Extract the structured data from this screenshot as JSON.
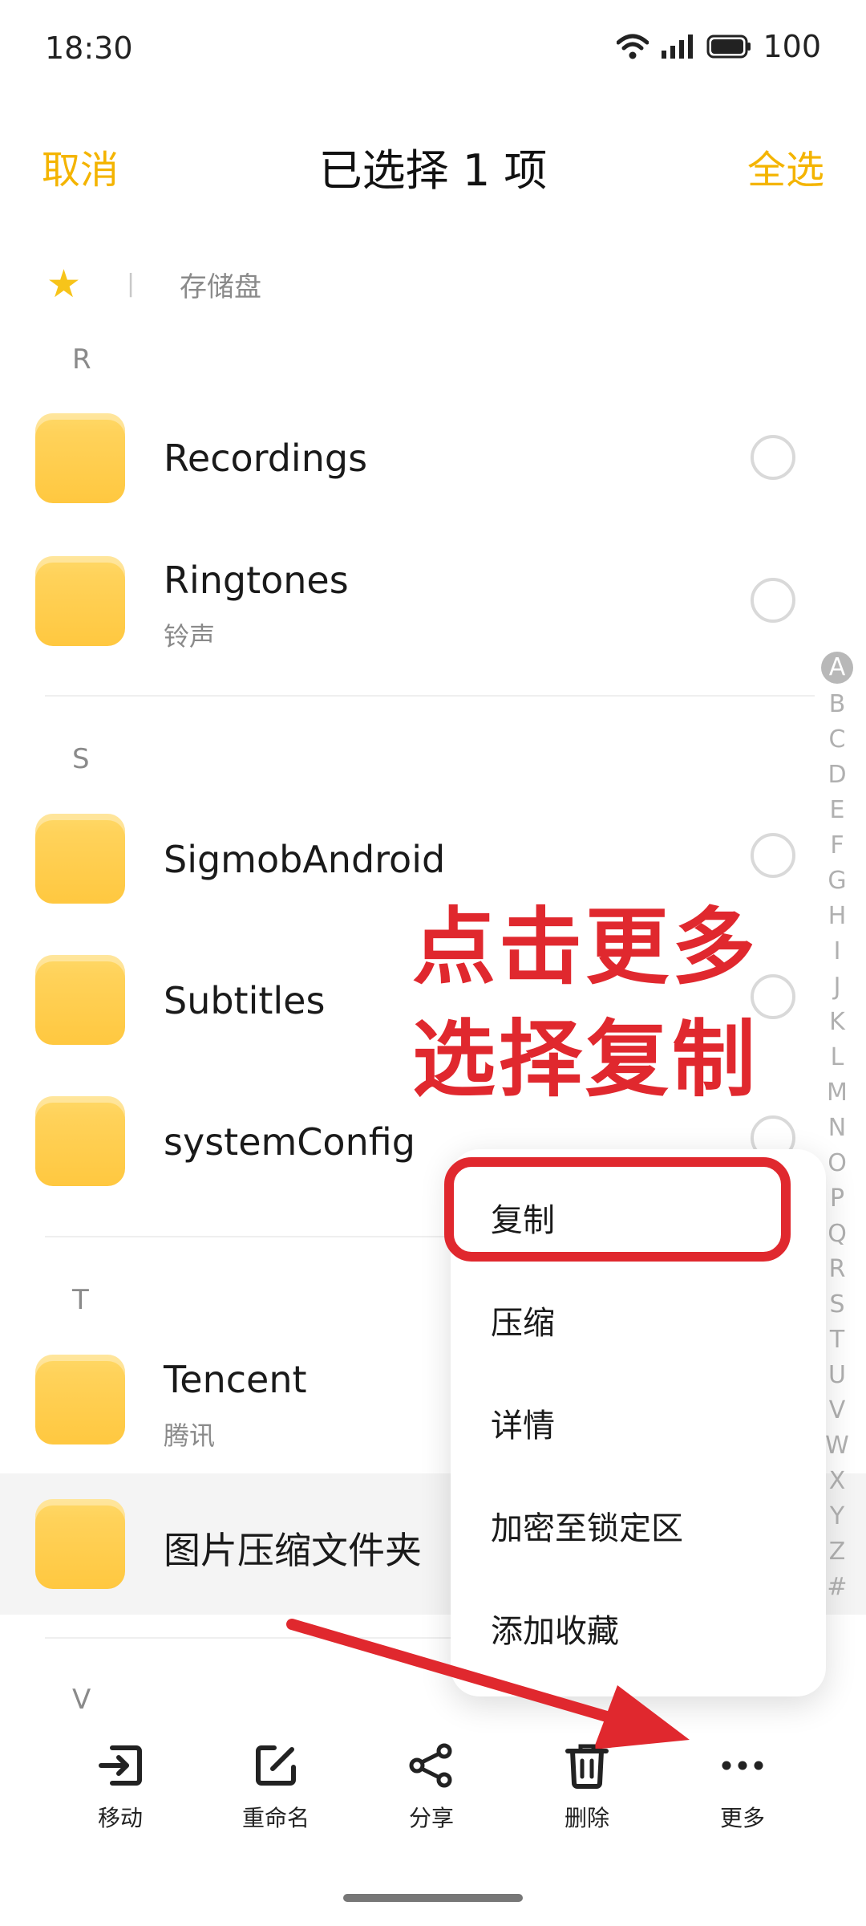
{
  "status_bar": {
    "time": "18:30",
    "battery": "100"
  },
  "title_bar": {
    "cancel": "取消",
    "title": "已选择 1 项",
    "select_all": "全选"
  },
  "breadcrumb": {
    "separator": "|",
    "storage": "存储盘"
  },
  "sections": [
    {
      "letter": "R",
      "items": [
        {
          "name": "Recordings",
          "subtitle": ""
        },
        {
          "name": "Ringtones",
          "subtitle": "铃声"
        }
      ]
    },
    {
      "letter": "S",
      "items": [
        {
          "name": "SigmobAndroid",
          "subtitle": ""
        },
        {
          "name": "Subtitles",
          "subtitle": ""
        },
        {
          "name": "systemConfig",
          "subtitle": ""
        }
      ]
    },
    {
      "letter": "T",
      "items": [
        {
          "name": "Tencent",
          "subtitle": "腾讯"
        },
        {
          "name": "图片压缩文件夹",
          "subtitle": "",
          "selected": true
        }
      ]
    },
    {
      "letter": "V",
      "items": []
    }
  ],
  "alphabet_index": [
    "A",
    "B",
    "C",
    "D",
    "E",
    "F",
    "G",
    "H",
    "I",
    "J",
    "K",
    "L",
    "M",
    "N",
    "O",
    "P",
    "Q",
    "R",
    "S",
    "T",
    "U",
    "V",
    "W",
    "X",
    "Y",
    "Z",
    "#"
  ],
  "annotation": {
    "line1": "点击更多",
    "line2": "选择复制"
  },
  "more_menu": [
    "复制",
    "压缩",
    "详情",
    "加密至锁定区",
    "添加收藏"
  ],
  "toolbar": {
    "move": "移动",
    "rename": "重命名",
    "share": "分享",
    "delete": "删除",
    "more": "更多"
  },
  "colors": {
    "accent": "#f4b400",
    "annotation_red": "#e0282e",
    "folder": "#ffd25a"
  }
}
